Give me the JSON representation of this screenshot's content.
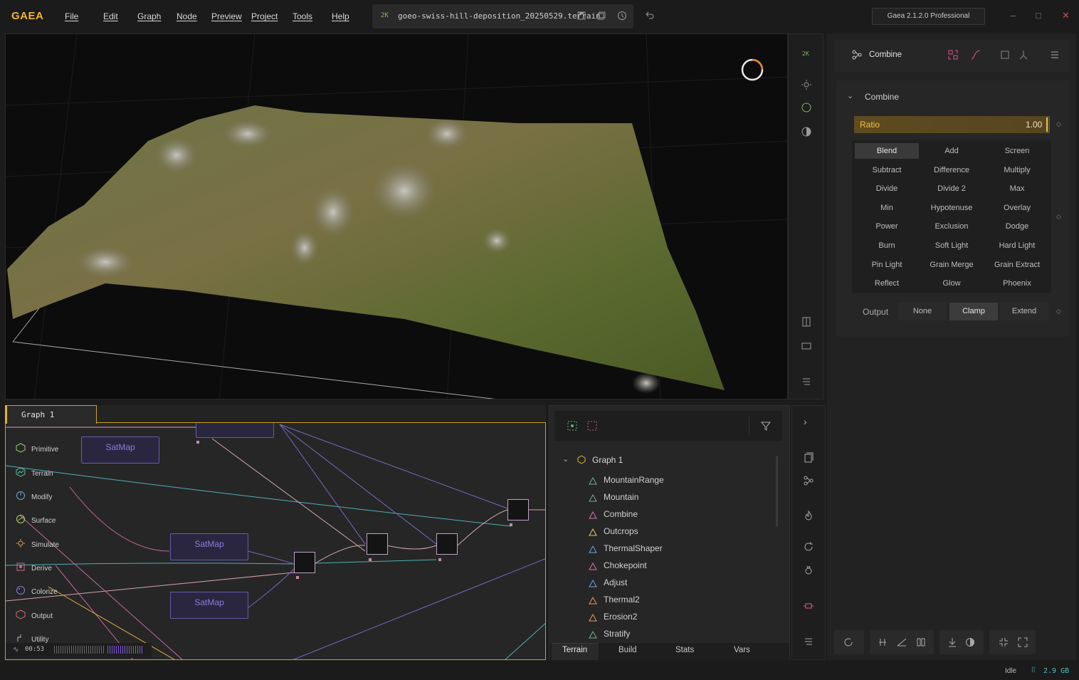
{
  "app": {
    "logo": "GAEA",
    "menu": [
      "File",
      "Edit",
      "Graph",
      "Node",
      "Preview",
      "Project",
      "Tools",
      "Help"
    ],
    "file": {
      "resolution": "2K",
      "name": "goeo-swiss-hill-deposition_20250529.terrain"
    },
    "version": "Gaea 2.1.2.0 Professional"
  },
  "viewport": {
    "resolution_badge": "2K"
  },
  "graph": {
    "tab_label": "Graph 1",
    "palette": [
      "Primitive",
      "Terrain",
      "Modify",
      "Surface",
      "Simulate",
      "Derive",
      "Colorize",
      "Output",
      "Utility"
    ],
    "nodes": [
      "SatMap",
      "SatMap",
      "SatMap"
    ],
    "timeline": {
      "time": "00:53"
    }
  },
  "explorer": {
    "graph_label": "Graph 1",
    "items": [
      {
        "label": "MountainRange",
        "icon": "mountain-range-icon",
        "color": "#6fb38a"
      },
      {
        "label": "Mountain",
        "icon": "mountain-icon",
        "color": "#6fb38a"
      },
      {
        "label": "Combine",
        "icon": "combine-icon",
        "color": "#d07ab0"
      },
      {
        "label": "Outcrops",
        "icon": "outcrops-icon",
        "color": "#e6c96a"
      },
      {
        "label": "ThermalShaper",
        "icon": "thermal-shaper-icon",
        "color": "#6fa6d6"
      },
      {
        "label": "Chokepoint",
        "icon": "chokepoint-icon",
        "color": "#d07ab0"
      },
      {
        "label": "Adjust",
        "icon": "adjust-icon",
        "color": "#6fa6d6"
      },
      {
        "label": "Thermal2",
        "icon": "thermal-icon",
        "color": "#e0a060"
      },
      {
        "label": "Erosion2",
        "icon": "erosion-icon",
        "color": "#e0a060"
      },
      {
        "label": "Stratify",
        "icon": "stratify-icon",
        "color": "#6fb38a"
      }
    ],
    "tabs": [
      "Terrain",
      "Build",
      "Stats",
      "Vars"
    ]
  },
  "properties": {
    "node_name": "Combine",
    "section": "Combine",
    "ratio": {
      "label": "Ratio",
      "value": "1.00",
      "fraction": 1.0
    },
    "blend_modes": [
      "Blend",
      "Add",
      "Screen",
      "Subtract",
      "Difference",
      "Multiply",
      "Divide",
      "Divide 2",
      "Max",
      "Min",
      "Hypotenuse",
      "Overlay",
      "Power",
      "Exclusion",
      "Dodge",
      "Burn",
      "Soft Light",
      "Hard Light",
      "Pin Light",
      "Grain Merge",
      "Grain Extract",
      "Reflect",
      "Glow",
      "Phoenix"
    ],
    "selected_blend": "Blend",
    "output": {
      "label": "Output",
      "options": [
        "None",
        "Clamp",
        "Extend"
      ],
      "selected": "Clamp"
    }
  },
  "status": {
    "state": "Idle",
    "memory": "2.9 GB"
  },
  "colors": {
    "accent": "#f2b632",
    "graph_border": "#c9a227",
    "node_purple": "#6b5aa8"
  }
}
